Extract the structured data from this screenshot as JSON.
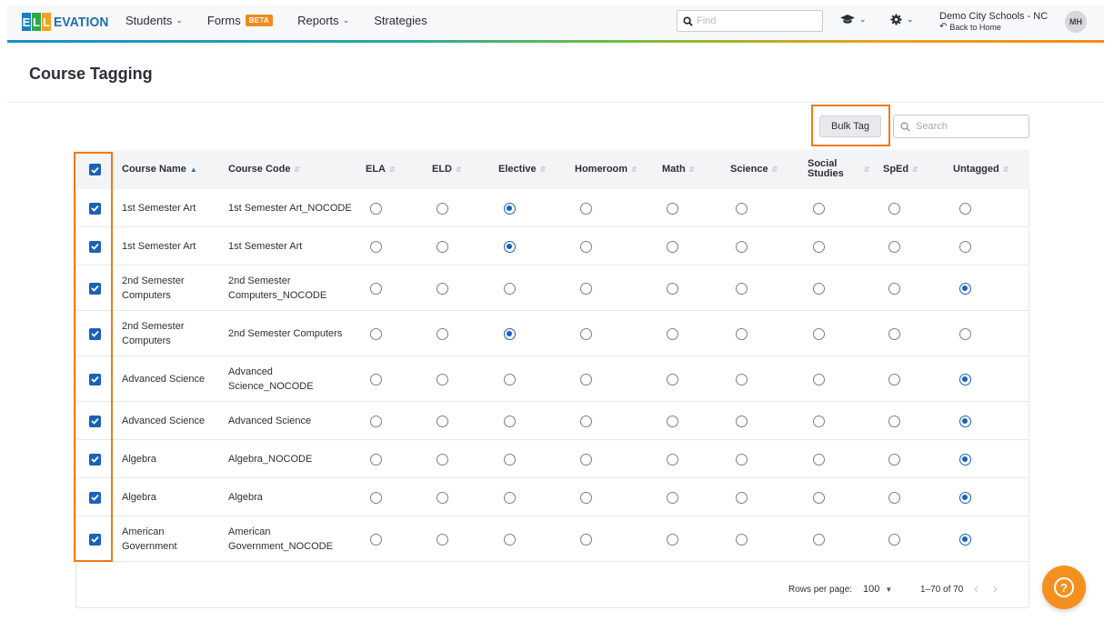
{
  "nav": {
    "logo_letters": [
      "E",
      "L",
      "L"
    ],
    "logo_text": "EVATION",
    "links": [
      {
        "label": "Students",
        "has_menu": true
      },
      {
        "label": "Forms",
        "badge": "BETA",
        "has_menu": false
      },
      {
        "label": "Reports",
        "has_menu": true
      },
      {
        "label": "Strategies",
        "has_menu": false
      }
    ],
    "find_placeholder": "Find",
    "district_name": "Demo City Schools - NC",
    "back_label": "Back to Home",
    "avatar_initials": "MH",
    "icons": [
      "graduation-cap-icon",
      "gear-icon"
    ]
  },
  "page": {
    "title": "Course Tagging"
  },
  "toolbar": {
    "bulk_tag_label": "Bulk Tag",
    "search_placeholder": "Search"
  },
  "table": {
    "columns": {
      "name": "Course Name",
      "code": "Course Code",
      "ela": "ELA",
      "eld": "ELD",
      "elective": "Elective",
      "homeroom": "Homeroom",
      "math": "Math",
      "science": "Science",
      "social_line1": "Social",
      "social_line2": "Studies",
      "sped": "SpEd",
      "untagged": "Untagged"
    },
    "tag_keys": [
      "ELA",
      "ELD",
      "Elective",
      "Homeroom",
      "Math",
      "Science",
      "Social Studies",
      "SpEd",
      "Untagged"
    ],
    "rows": [
      {
        "name": [
          "1st Semester Art"
        ],
        "code": [
          "1st Semester Art_NOCODE"
        ],
        "tag": "Elective",
        "checked": true
      },
      {
        "name": [
          "1st Semester Art"
        ],
        "code": [
          "1st Semester Art"
        ],
        "tag": "Elective",
        "checked": true
      },
      {
        "name": [
          "2nd Semester",
          "Computers"
        ],
        "code": [
          "2nd Semester",
          "Computers_NOCODE"
        ],
        "tag": "Untagged",
        "checked": true
      },
      {
        "name": [
          "2nd Semester",
          "Computers"
        ],
        "code": [
          "2nd Semester Computers"
        ],
        "tag": "Elective",
        "checked": true
      },
      {
        "name": [
          "Advanced Science"
        ],
        "code": [
          "Advanced",
          "Science_NOCODE"
        ],
        "tag": "Untagged",
        "checked": true
      },
      {
        "name": [
          "Advanced Science"
        ],
        "code": [
          "Advanced Science"
        ],
        "tag": "Untagged",
        "checked": true
      },
      {
        "name": [
          "Algebra"
        ],
        "code": [
          "Algebra_NOCODE"
        ],
        "tag": "Untagged",
        "checked": true
      },
      {
        "name": [
          "Algebra"
        ],
        "code": [
          "Algebra"
        ],
        "tag": "Untagged",
        "checked": true
      },
      {
        "name": [
          "American",
          "Government"
        ],
        "code": [
          "American",
          "Government_NOCODE"
        ],
        "tag": "Untagged",
        "checked": true
      }
    ]
  },
  "pagination": {
    "rows_per_page_label": "Rows per page:",
    "rows_per_page_value": "100",
    "range": "1–70 of 70"
  },
  "colors": {
    "accent_orange": "#f07a1a",
    "check_blue": "#1a62b8",
    "help_orange": "#f5901f"
  }
}
